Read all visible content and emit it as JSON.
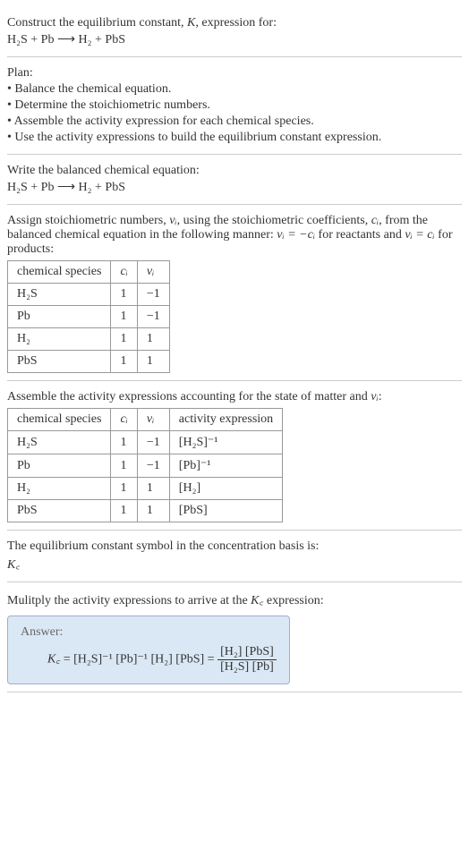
{
  "title": {
    "line1_prefix": "Construct the equilibrium constant, ",
    "line1_var": "K",
    "line1_suffix": ", expression for:",
    "equation": "H₂S + Pb ⟶ H₂ + PbS"
  },
  "plan": {
    "header": "Plan:",
    "items": [
      "• Balance the chemical equation.",
      "• Determine the stoichiometric numbers.",
      "• Assemble the activity expression for each chemical species.",
      "• Use the activity expressions to build the equilibrium constant expression."
    ]
  },
  "balanced": {
    "header": "Write the balanced chemical equation:",
    "equation": "H₂S + Pb ⟶ H₂ + PbS"
  },
  "stoich": {
    "text1": "Assign stoichiometric numbers, ",
    "text2": ", using the stoichiometric coefficients, ",
    "text3": ", from the balanced chemical equation in the following manner: ",
    "text4": " for reactants and ",
    "text5": " for products:",
    "nu_i": "νᵢ",
    "c_i": "cᵢ",
    "eq_react": "νᵢ = −cᵢ",
    "eq_prod": "νᵢ = cᵢ",
    "headers": [
      "chemical species",
      "cᵢ",
      "νᵢ"
    ],
    "rows": [
      {
        "species": "H₂S",
        "c": "1",
        "nu": "−1"
      },
      {
        "species": "Pb",
        "c": "1",
        "nu": "−1"
      },
      {
        "species": "H₂",
        "c": "1",
        "nu": "1"
      },
      {
        "species": "PbS",
        "c": "1",
        "nu": "1"
      }
    ]
  },
  "activity": {
    "header_prefix": "Assemble the activity expressions accounting for the state of matter and ",
    "header_var": "νᵢ",
    "header_suffix": ":",
    "headers": [
      "chemical species",
      "cᵢ",
      "νᵢ",
      "activity expression"
    ],
    "rows": [
      {
        "species": "H₂S",
        "c": "1",
        "nu": "−1",
        "expr": "[H₂S]⁻¹"
      },
      {
        "species": "Pb",
        "c": "1",
        "nu": "−1",
        "expr": "[Pb]⁻¹"
      },
      {
        "species": "H₂",
        "c": "1",
        "nu": "1",
        "expr": "[H₂]"
      },
      {
        "species": "PbS",
        "c": "1",
        "nu": "1",
        "expr": "[PbS]"
      }
    ]
  },
  "symbol": {
    "text": "The equilibrium constant symbol in the concentration basis is:",
    "kc": "K꜀"
  },
  "multiply": {
    "text_prefix": "Mulitply the activity expressions to arrive at the ",
    "text_var": "K꜀",
    "text_suffix": " expression:",
    "answer_label": "Answer:",
    "kc": "K꜀",
    "lhs": " = [H₂S]⁻¹ [Pb]⁻¹ [H₂] [PbS] = ",
    "frac_num": "[H₂] [PbS]",
    "frac_den": "[H₂S] [Pb]"
  }
}
